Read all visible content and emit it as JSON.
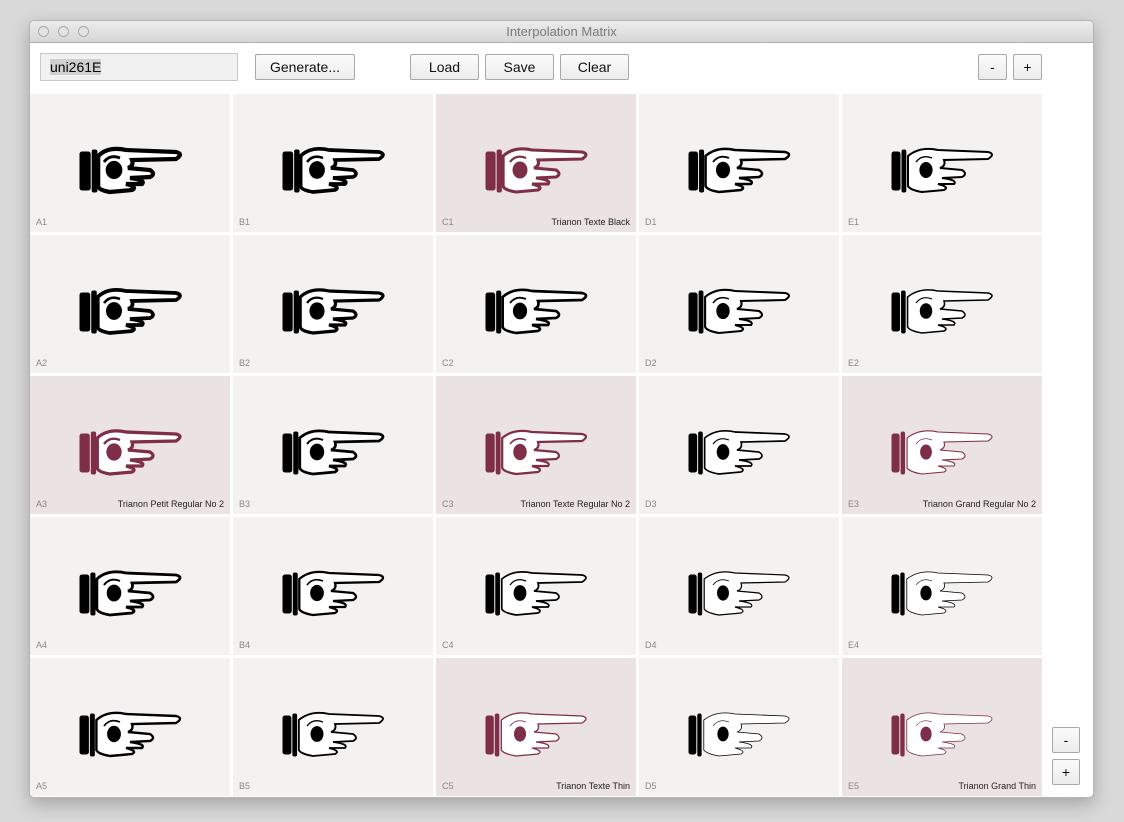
{
  "window": {
    "title": "Interpolation Matrix"
  },
  "toolbar": {
    "glyph_name": "uni261E",
    "generate_label": "Generate...",
    "load_label": "Load",
    "save_label": "Save",
    "clear_label": "Clear",
    "minus_label": "-",
    "plus_label": "+"
  },
  "side": {
    "minus_label": "-",
    "plus_label": "+"
  },
  "colors": {
    "master_glyph": "#7f2e47",
    "glyph": "#000000",
    "master_cell": "#ebe3e3",
    "cell": "#f3f2f1"
  },
  "matrix": {
    "rows": [
      [
        {
          "label": "A1",
          "master": ""
        },
        {
          "label": "B1",
          "master": ""
        },
        {
          "label": "C1",
          "master": "Trianon Texte Black"
        },
        {
          "label": "D1",
          "master": ""
        },
        {
          "label": "E1",
          "master": ""
        }
      ],
      [
        {
          "label": "A2",
          "master": ""
        },
        {
          "label": "B2",
          "master": ""
        },
        {
          "label": "C2",
          "master": ""
        },
        {
          "label": "D2",
          "master": ""
        },
        {
          "label": "E2",
          "master": ""
        }
      ],
      [
        {
          "label": "A3",
          "master": "Trianon Petit Regular No 2"
        },
        {
          "label": "B3",
          "master": ""
        },
        {
          "label": "C3",
          "master": "Trianon Texte Regular No 2"
        },
        {
          "label": "D3",
          "master": ""
        },
        {
          "label": "E3",
          "master": "Trianon Grand Regular No 2"
        }
      ],
      [
        {
          "label": "A4",
          "master": ""
        },
        {
          "label": "B4",
          "master": ""
        },
        {
          "label": "C4",
          "master": ""
        },
        {
          "label": "D4",
          "master": ""
        },
        {
          "label": "E4",
          "master": ""
        }
      ],
      [
        {
          "label": "A5",
          "master": ""
        },
        {
          "label": "B5",
          "master": ""
        },
        {
          "label": "C5",
          "master": "Trianon Texte Thin"
        },
        {
          "label": "D5",
          "master": ""
        },
        {
          "label": "E5",
          "master": "Trianon Grand Thin"
        }
      ]
    ]
  }
}
